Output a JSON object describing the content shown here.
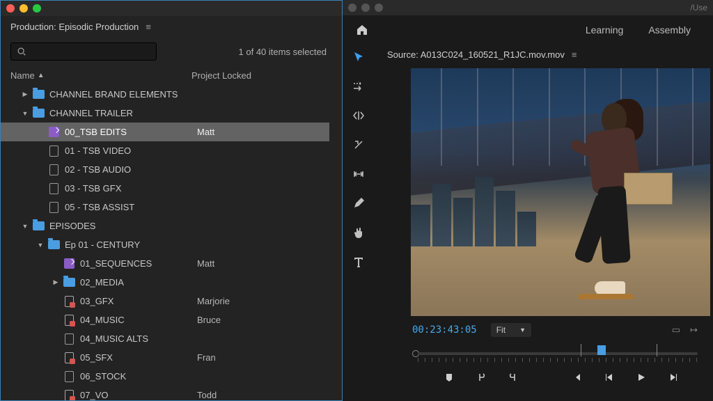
{
  "production": {
    "title": "Production: Episodic Production",
    "selection_status": "1 of 40 items selected",
    "columns": {
      "name": "Name",
      "locked": "Project Locked"
    }
  },
  "tree": [
    {
      "indent": 1,
      "chev": "right",
      "icon": "folder",
      "label": "CHANNEL BRAND ELEMENTS",
      "lock": ""
    },
    {
      "indent": 1,
      "chev": "down",
      "icon": "folder",
      "label": "CHANNEL TRAILER",
      "lock": ""
    },
    {
      "indent": 2,
      "chev": "",
      "icon": "prproj",
      "label": "00_TSB EDITS",
      "lock": "Matt",
      "selected": true
    },
    {
      "indent": 2,
      "chev": "",
      "icon": "file",
      "label": "01 - TSB VIDEO",
      "lock": ""
    },
    {
      "indent": 2,
      "chev": "",
      "icon": "file",
      "label": "02 - TSB AUDIO",
      "lock": ""
    },
    {
      "indent": 2,
      "chev": "",
      "icon": "file",
      "label": "03 - TSB GFX",
      "lock": ""
    },
    {
      "indent": 2,
      "chev": "",
      "icon": "file",
      "label": "05 - TSB ASSIST",
      "lock": ""
    },
    {
      "indent": 1,
      "chev": "down",
      "icon": "folder",
      "label": "EPISODES",
      "lock": ""
    },
    {
      "indent": 2,
      "chev": "down",
      "icon": "folder",
      "label": "Ep 01 - CENTURY",
      "lock": ""
    },
    {
      "indent": 3,
      "chev": "",
      "icon": "prproj",
      "label": "01_SEQUENCES",
      "lock": "Matt"
    },
    {
      "indent": 3,
      "chev": "right",
      "icon": "folder",
      "label": "02_MEDIA",
      "lock": ""
    },
    {
      "indent": 3,
      "chev": "",
      "icon": "locked",
      "label": "03_GFX",
      "lock": "Marjorie"
    },
    {
      "indent": 3,
      "chev": "",
      "icon": "locked",
      "label": "04_MUSIC",
      "lock": "Bruce"
    },
    {
      "indent": 3,
      "chev": "",
      "icon": "file",
      "label": "04_MUSIC ALTS",
      "lock": ""
    },
    {
      "indent": 3,
      "chev": "",
      "icon": "locked",
      "label": "05_SFX",
      "lock": "Fran"
    },
    {
      "indent": 3,
      "chev": "",
      "icon": "file",
      "label": "06_STOCK",
      "lock": ""
    },
    {
      "indent": 3,
      "chev": "",
      "icon": "locked",
      "label": "07_VO",
      "lock": "Todd"
    }
  ],
  "topbar": {
    "learning": "Learning",
    "assembly": "Assembly",
    "path": "/Use"
  },
  "source": {
    "title": "Source: A013C024_160521_R1JC.mov.mov",
    "timecode": "00:23:43:05",
    "zoom": "Fit"
  },
  "tools": [
    "selection",
    "ripple-edit",
    "rolling-edit",
    "rate-stretch",
    "slip",
    "pen",
    "hand",
    "type"
  ],
  "transport": [
    "mark-in",
    "set-in",
    "set-out",
    "go-in",
    "step-back",
    "play",
    "step-fwd"
  ]
}
